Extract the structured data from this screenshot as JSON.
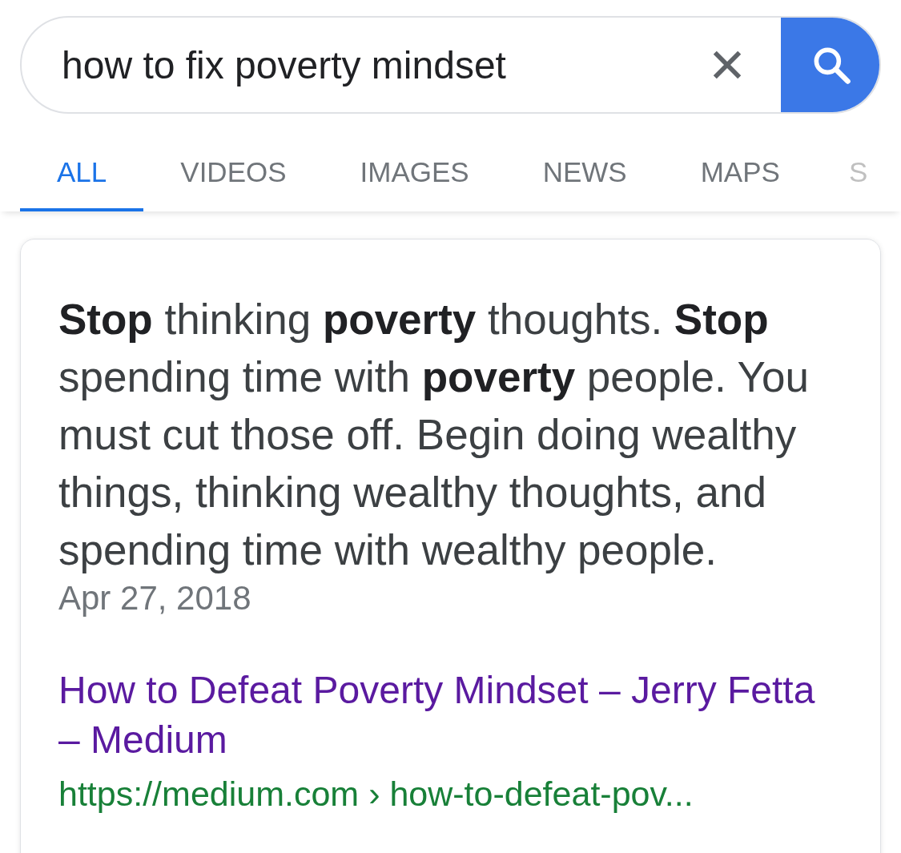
{
  "search": {
    "value": "how to fix poverty mindset"
  },
  "tabs": [
    {
      "label": "ALL",
      "selected": true
    },
    {
      "label": "VIDEOS",
      "selected": false
    },
    {
      "label": "IMAGES",
      "selected": false
    },
    {
      "label": "NEWS",
      "selected": false
    },
    {
      "label": "MAPS",
      "selected": false
    },
    {
      "label": "S",
      "selected": false
    }
  ],
  "result": {
    "snippet": "**Stop** thinking **poverty** thoughts. **Stop** spending time with **poverty** people. You must cut those off. Begin doing wealthy things, thinking wealthy thoughts, and spending time with wealthy people.",
    "date": "Apr 27, 2018",
    "title": "How to Defeat Poverty Mindset – Jerry Fetta – Medium",
    "url": "https://medium.com › how-to-defeat-pov..."
  }
}
